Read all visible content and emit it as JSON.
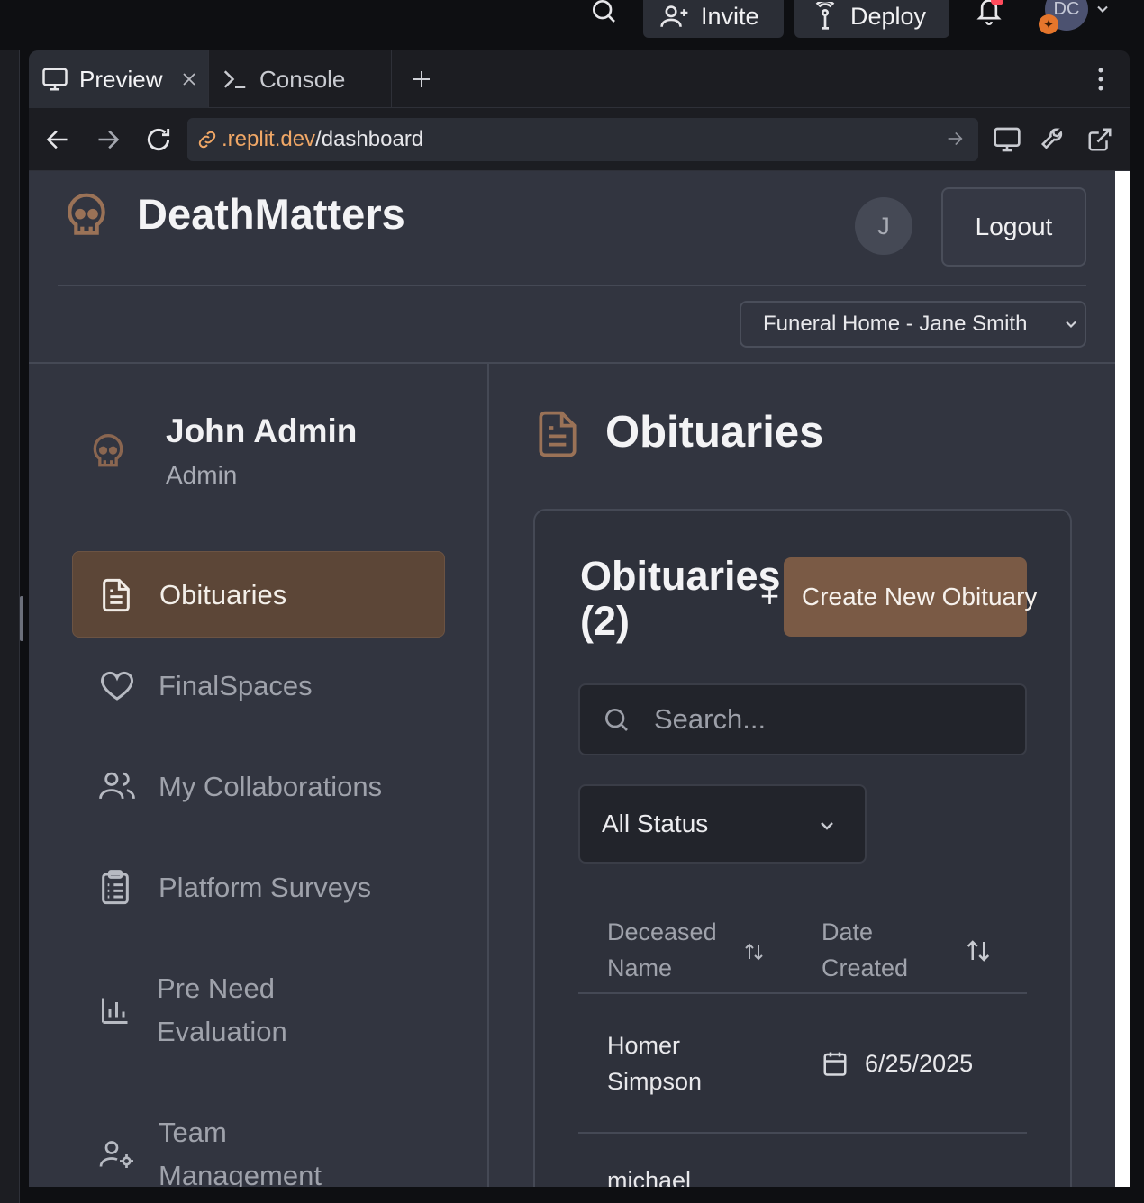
{
  "topbar": {
    "invite_label": "Invite",
    "deploy_label": "Deploy",
    "user_initials": "DC"
  },
  "tabs": [
    {
      "label": "Preview",
      "icon": "monitor-icon"
    },
    {
      "label": "Console",
      "icon": "terminal-icon"
    }
  ],
  "browser": {
    "url_domain": ".replit.dev",
    "url_path": "/dashboard"
  },
  "app": {
    "brand": "DeathMatters",
    "avatar_initial": "J",
    "logout_label": "Logout",
    "org_select": "Funeral Home - Jane Smith"
  },
  "user": {
    "name": "John Admin",
    "role": "Admin"
  },
  "sidebar": {
    "items": [
      {
        "label": "Obituaries",
        "icon": "document-icon",
        "active": true
      },
      {
        "label": "FinalSpaces",
        "icon": "heart-icon"
      },
      {
        "label": "My Collaborations",
        "icon": "users-icon"
      },
      {
        "label": "Platform Surveys",
        "icon": "clipboard-list-icon"
      },
      {
        "label": "Pre Need Evaluation",
        "label_line1": "Pre Need",
        "label_line2": "Evaluation",
        "icon": "bar-chart-icon"
      },
      {
        "label": "Team Management",
        "label_line1": "Team",
        "label_line2": "Management",
        "icon": "user-cog-icon"
      }
    ]
  },
  "main": {
    "title": "Obituaries",
    "card_title_line1": "Obituaries",
    "card_title_line2": "(2)",
    "create_label": "Create New Obituary",
    "search_placeholder": "Search...",
    "status_filter": "All Status",
    "columns": {
      "name_line1": "Deceased",
      "name_line2": "Name",
      "date_line1": "Date",
      "date_line2": "Created"
    },
    "rows": [
      {
        "name_line1": "Homer",
        "name_line2": "Simpson",
        "date": "6/25/2025"
      },
      {
        "name_line1": "michael",
        "name_line2": "",
        "date": ""
      }
    ]
  },
  "colors": {
    "accent": "#7a5a45",
    "active_nav": "#5c4637",
    "url_domain": "#f0a766",
    "bg": "#323540"
  }
}
